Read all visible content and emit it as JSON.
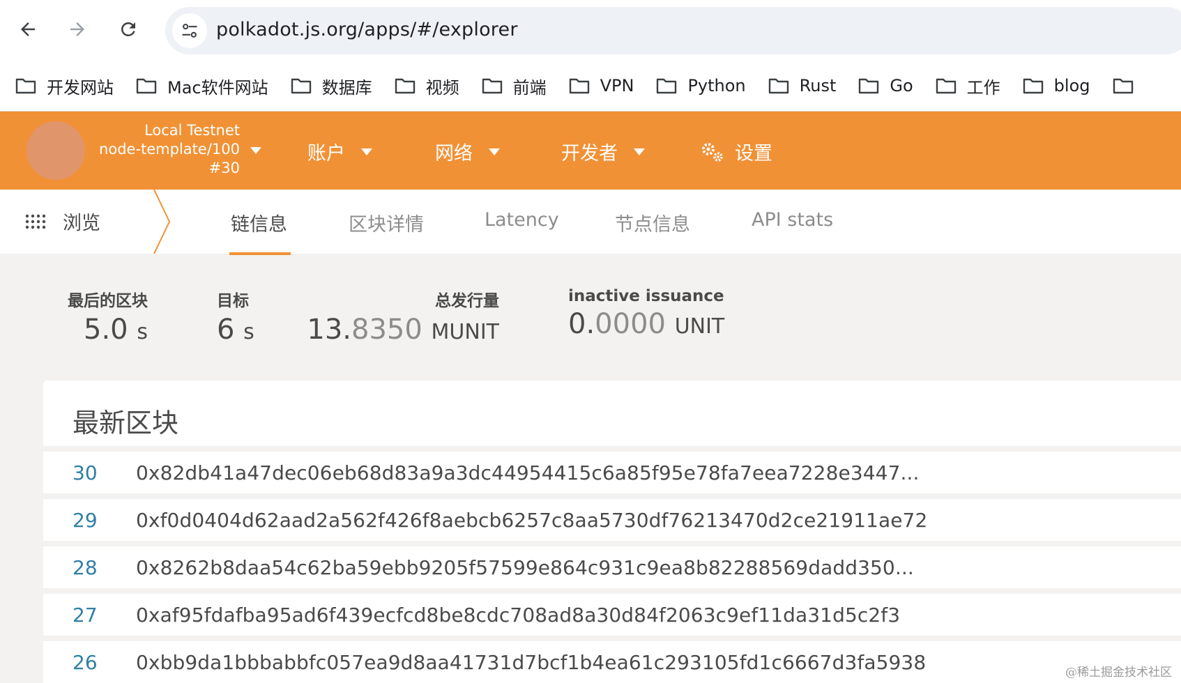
{
  "browser": {
    "url": "polkadot.js.org/apps/#/explorer",
    "bookmarks": [
      "开发网站",
      "Mac软件网站",
      "数据库",
      "视频",
      "前端",
      "VPN",
      "Python",
      "Rust",
      "Go",
      "工作",
      "blog"
    ]
  },
  "header": {
    "chain_name": "Local Testnet",
    "node_version": "node-template/100",
    "best_block": "#30",
    "menus": {
      "accounts": "账户",
      "network": "网络",
      "developer": "开发者",
      "settings": "设置"
    }
  },
  "subnav": {
    "browse": "浏览",
    "tabs": [
      "链信息",
      "区块详情",
      "Latency",
      "节点信息",
      "API stats"
    ]
  },
  "summary": {
    "last_block": {
      "label": "最后的区块",
      "value": "5.0",
      "unit": "s"
    },
    "target": {
      "label": "目标",
      "value": "6",
      "unit": "s"
    },
    "total_issuance": {
      "label": "总发行量",
      "major": "13.",
      "minor": "8350",
      "unit": "MUNIT"
    },
    "inactive_issuance": {
      "label": "inactive issuance",
      "major": "0.",
      "minor": "0000",
      "unit": "UNIT"
    }
  },
  "recent_blocks": {
    "title": "最新区块",
    "rows": [
      {
        "number": "30",
        "hash": "0x82db41a47dec06eb68d83a9a3dc44954415c6a85f95e78fa7eea7228e3447..."
      },
      {
        "number": "29",
        "hash": "0xf0d0404d62aad2a562f426f8aebcb6257c8aa5730df76213470d2ce21911ae72"
      },
      {
        "number": "28",
        "hash": "0x8262b8daa54c62ba59ebb9205f57599e864c931c9ea8b82288569dadd350..."
      },
      {
        "number": "27",
        "hash": "0xaf95fdafba95ad6f439ecfcd8be8cdc708ad8a30d84f2063c9ef11da31d5c2f3"
      },
      {
        "number": "26",
        "hash": "0xbb9da1bbbabbfc057ea9d8aa41731d7bcf1b4ea61c293105fd1c6667d3fa5938"
      }
    ]
  },
  "watermark": "@稀土掘金技术社区",
  "colors": {
    "accent": "#f19135",
    "block_number": "#2e7fa6"
  }
}
